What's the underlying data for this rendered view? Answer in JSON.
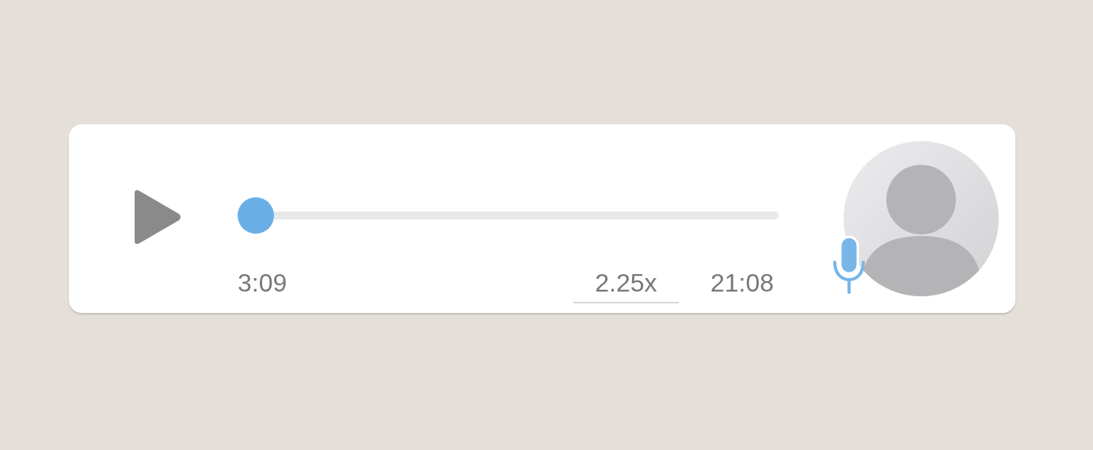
{
  "voice_message": {
    "playing": false,
    "level": 0,
    "current_time": "3:09",
    "speed": "2.25x",
    "duration": "21:08"
  }
}
